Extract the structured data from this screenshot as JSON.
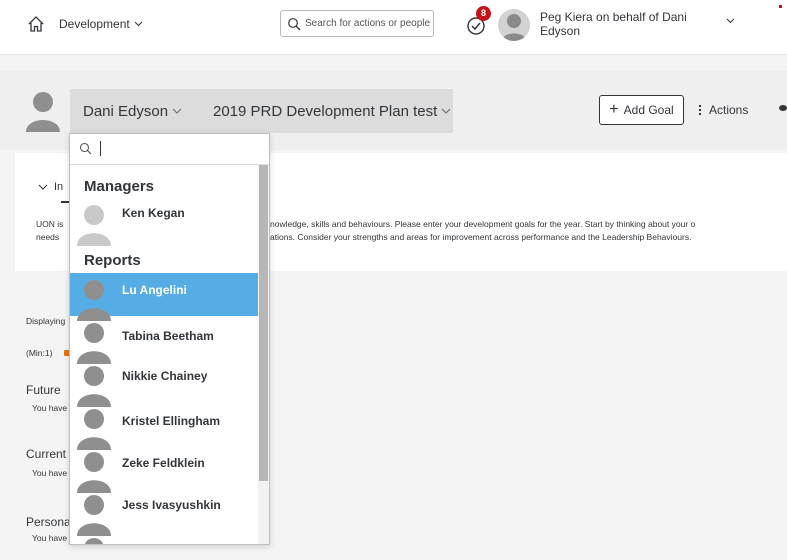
{
  "shell": {
    "module_label": "Development",
    "search_placeholder": "Search for actions or people",
    "notification_count": "8",
    "user_label_line1": "Peg Kiera on behalf of Dani",
    "user_label_line2": "Edyson"
  },
  "header": {
    "person_name": "Dani Edyson",
    "plan_name": "2019 PRD Development Plan test",
    "add_goal_label": "Add Goal",
    "actions_label": "Actions"
  },
  "intro": {
    "heading": "In",
    "line1_left": "UON is",
    "line2_left": "needs",
    "line1_right": "nowledge, skills and behaviours.  Please enter your development goals for the year.  Start by thinking about your o",
    "line2_right": "ations.  Consider your strengths and areas for improvement across performance and the Leadership Behaviours."
  },
  "main": {
    "displaying": "Displaying",
    "min": "(Min:1)",
    "sections": [
      {
        "title": "Future",
        "sub": "You have"
      },
      {
        "title": "Current",
        "sub": "You have"
      },
      {
        "title": "Personal",
        "sub": "You have"
      }
    ]
  },
  "dropdown": {
    "search_value": "",
    "groups": {
      "managers": "Managers",
      "reports": "Reports"
    },
    "managers": [
      "Ken Kegan"
    ],
    "reports": [
      "Lu Angelini",
      "Tabina Beetham",
      "Nikkie Chainey",
      "Kristel Ellingham",
      "Zeke Feldklein",
      "Jess Ivasyushkin"
    ],
    "selected": "Lu Angelini"
  },
  "colors": {
    "selected_row": "#56ade6",
    "badge": "#c8121b",
    "accent_warning": "#e9730c"
  }
}
